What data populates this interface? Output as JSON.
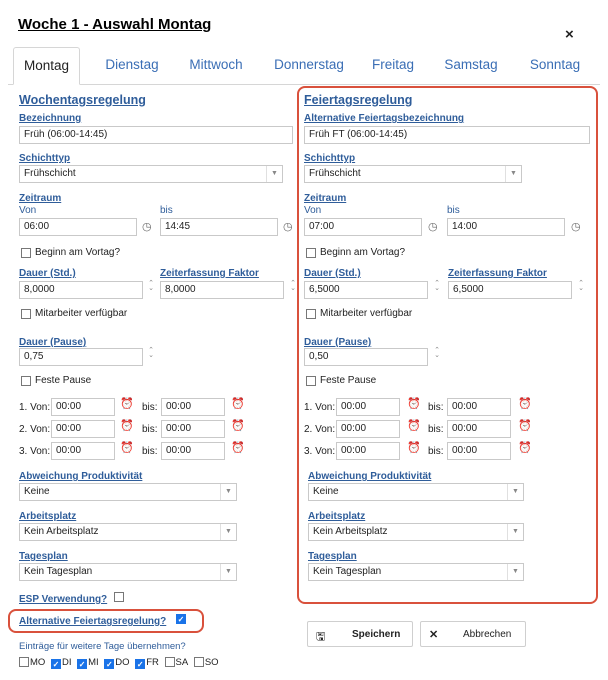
{
  "dialog": {
    "title": "Woche 1 - Auswahl Montag",
    "close": "×"
  },
  "tabs": [
    "Montag",
    "Dienstag",
    "Mittwoch",
    "Donnerstag",
    "Freitag",
    "Samstag",
    "Sonntag"
  ],
  "left": {
    "section": "Wochentagsregelung",
    "name_label": "Bezeichnung",
    "name_value": "Früh (06:00-14:45)",
    "shift_label": "Schichttyp",
    "shift_value": "Frühschicht",
    "period_label": "Zeitraum",
    "from_label": "Von",
    "to_label": "bis",
    "from_value": "06:00",
    "to_value": "14:45",
    "prevday": "Beginn am Vortag?",
    "duration_label": "Dauer (Std.)",
    "duration_value": "8,0000",
    "factor_label": "Zeiterfassung Faktor",
    "factor_value": "8,0000",
    "employee": "Mitarbeiter verfügbar",
    "pause_label": "Dauer (Pause)",
    "pause_value": "0,75",
    "fixed_pause": "Feste Pause",
    "pauses": [
      {
        "from_label": "1. Von:",
        "from": "00:00",
        "to_label": "bis:",
        "to": "00:00"
      },
      {
        "from_label": "2. Von:",
        "from": "00:00",
        "to_label": "bis:",
        "to": "00:00"
      },
      {
        "from_label": "3. Von:",
        "from": "00:00",
        "to_label": "bis:",
        "to": "00:00"
      }
    ],
    "prod_label": "Abweichung Produktivität",
    "prod_value": "Keine",
    "work_label": "Arbeitsplatz",
    "work_value": "Kein Arbeitsplatz",
    "plan_label": "Tagesplan",
    "plan_value": "Kein Tagesplan"
  },
  "right": {
    "section": "Feiertagsregelung",
    "name_label": "Alternative Feiertagsbezeichnung",
    "name_value": "Früh FT (06:00-14:45)",
    "shift_label": "Schichttyp",
    "shift_value": "Frühschicht",
    "period_label": "Zeitraum",
    "from_label": "Von",
    "to_label": "bis",
    "from_value": "07:00",
    "to_value": "14:00",
    "prevday": "Beginn am Vortag?",
    "duration_label": "Dauer (Std.)",
    "duration_value": "6,5000",
    "factor_label": "Zeiterfassung Faktor",
    "factor_value": "6,5000",
    "employee": "Mitarbeiter verfügbar",
    "pause_label": "Dauer (Pause)",
    "pause_value": "0,50",
    "fixed_pause": "Feste Pause",
    "pauses": [
      {
        "from_label": "1. Von:",
        "from": "00:00",
        "to_label": "bis:",
        "to": "00:00"
      },
      {
        "from_label": "2. Von:",
        "from": "00:00",
        "to_label": "bis:",
        "to": "00:00"
      },
      {
        "from_label": "3. Von:",
        "from": "00:00",
        "to_label": "bis:",
        "to": "00:00"
      }
    ],
    "prod_label": "Abweichung Produktivität",
    "prod_value": "Keine",
    "work_label": "Arbeitsplatz",
    "work_value": "Kein Arbeitsplatz",
    "plan_label": "Tagesplan",
    "plan_value": "Kein Tagesplan"
  },
  "esp_label": "ESP Verwendung?",
  "alt_holiday_label": "Alternative Feiertagsregelung?",
  "copy_label": "Einträge für weitere Tage übernehmen?",
  "days": [
    {
      "label": "MO",
      "checked": false
    },
    {
      "label": "DI",
      "checked": true
    },
    {
      "label": "MI",
      "checked": true
    },
    {
      "label": "DO",
      "checked": true
    },
    {
      "label": "FR",
      "checked": true
    },
    {
      "label": "SA",
      "checked": false
    },
    {
      "label": "SO",
      "checked": false
    }
  ],
  "buttons": {
    "save": "Speichern",
    "cancel": "Abbrechen"
  },
  "icons": {
    "clock": "clock-icon",
    "alarm": "alarm-clock-icon",
    "save": "floppy-disk-icon",
    "cancel": "x-icon"
  },
  "colors": {
    "link": "#2f5d9a",
    "tab": "#3a6eb5",
    "highlight": "#d9513c",
    "checkbox": "#1a73e8"
  }
}
